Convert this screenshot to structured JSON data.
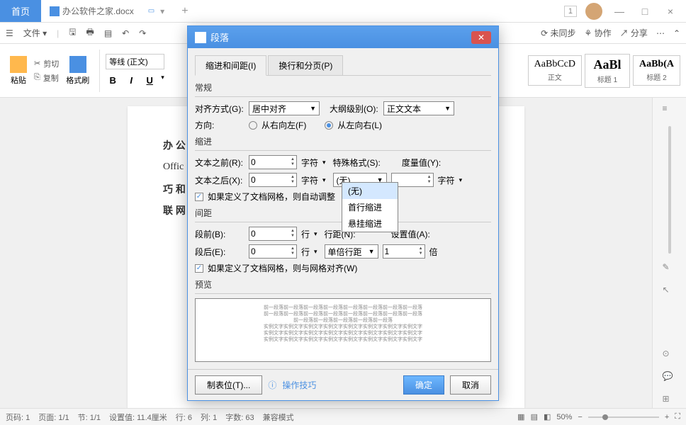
{
  "titlebar": {
    "home": "首页",
    "doc_name": "办公软件之家.docx",
    "badge": "1"
  },
  "menubar": {
    "file": "文件",
    "sync": "未同步",
    "collab": "协作",
    "share": "分享"
  },
  "toolbar": {
    "paste": "粘贴",
    "cut": "剪切",
    "copy": "复制",
    "format_painter": "格式刷",
    "font_style": "等线 (正文)",
    "style1_text": "AaBbCcD",
    "style1_label": "正文",
    "style2_text": "AaBl",
    "style2_label": "标题 1",
    "style3_text": "AaBb(A",
    "style3_label": "标题 2"
  },
  "doc": {
    "line1": "办 公",
    "line2": "Offic",
    "line3": "巧 和",
    "line4": "联 网"
  },
  "dialog": {
    "title": "段落",
    "tab1": "缩进和间距(I)",
    "tab2": "换行和分页(P)",
    "section_general": "常规",
    "align_label": "对齐方式(G):",
    "align_value": "居中对齐",
    "outline_label": "大纲级别(O):",
    "outline_value": "正文文本",
    "direction_label": "方向:",
    "rtl": "从右向左(F)",
    "ltr": "从左向右(L)",
    "section_indent": "缩进",
    "before_text": "文本之前(R):",
    "before_val": "0",
    "after_text": "文本之后(X):",
    "after_val": "0",
    "char_unit": "字符",
    "special_label": "特殊格式(S):",
    "special_value": "(无)",
    "measure_label": "度量值(Y):",
    "auto_adjust": "如果定义了文档网格，则自动调整",
    "section_spacing": "间距",
    "space_before": "段前(B):",
    "space_before_val": "0",
    "space_after": "段后(E):",
    "space_after_val": "0",
    "line_unit": "行",
    "line_spacing_label": "行距(N):",
    "line_spacing_value": "单倍行距",
    "set_value_label": "设置值(A):",
    "set_value": "1",
    "times_unit": "倍",
    "grid_align": "如果定义了文档网格，则与网格对齐(W)",
    "section_preview": "预览",
    "tabstop": "制表位(T)...",
    "tips": "操作技巧",
    "ok": "确定",
    "cancel": "取消"
  },
  "dropdown": {
    "item1": "(无)",
    "item2": "首行缩进",
    "item3": "悬挂缩进"
  },
  "statusbar": {
    "page_num": "页码: 1",
    "page": "页面: 1/1",
    "section": "节: 1/1",
    "setval": "设置值: 11.4厘米",
    "row": "行: 6",
    "col": "列: 1",
    "chars": "字数: 63",
    "compat": "兼容模式",
    "zoom": "50%"
  }
}
